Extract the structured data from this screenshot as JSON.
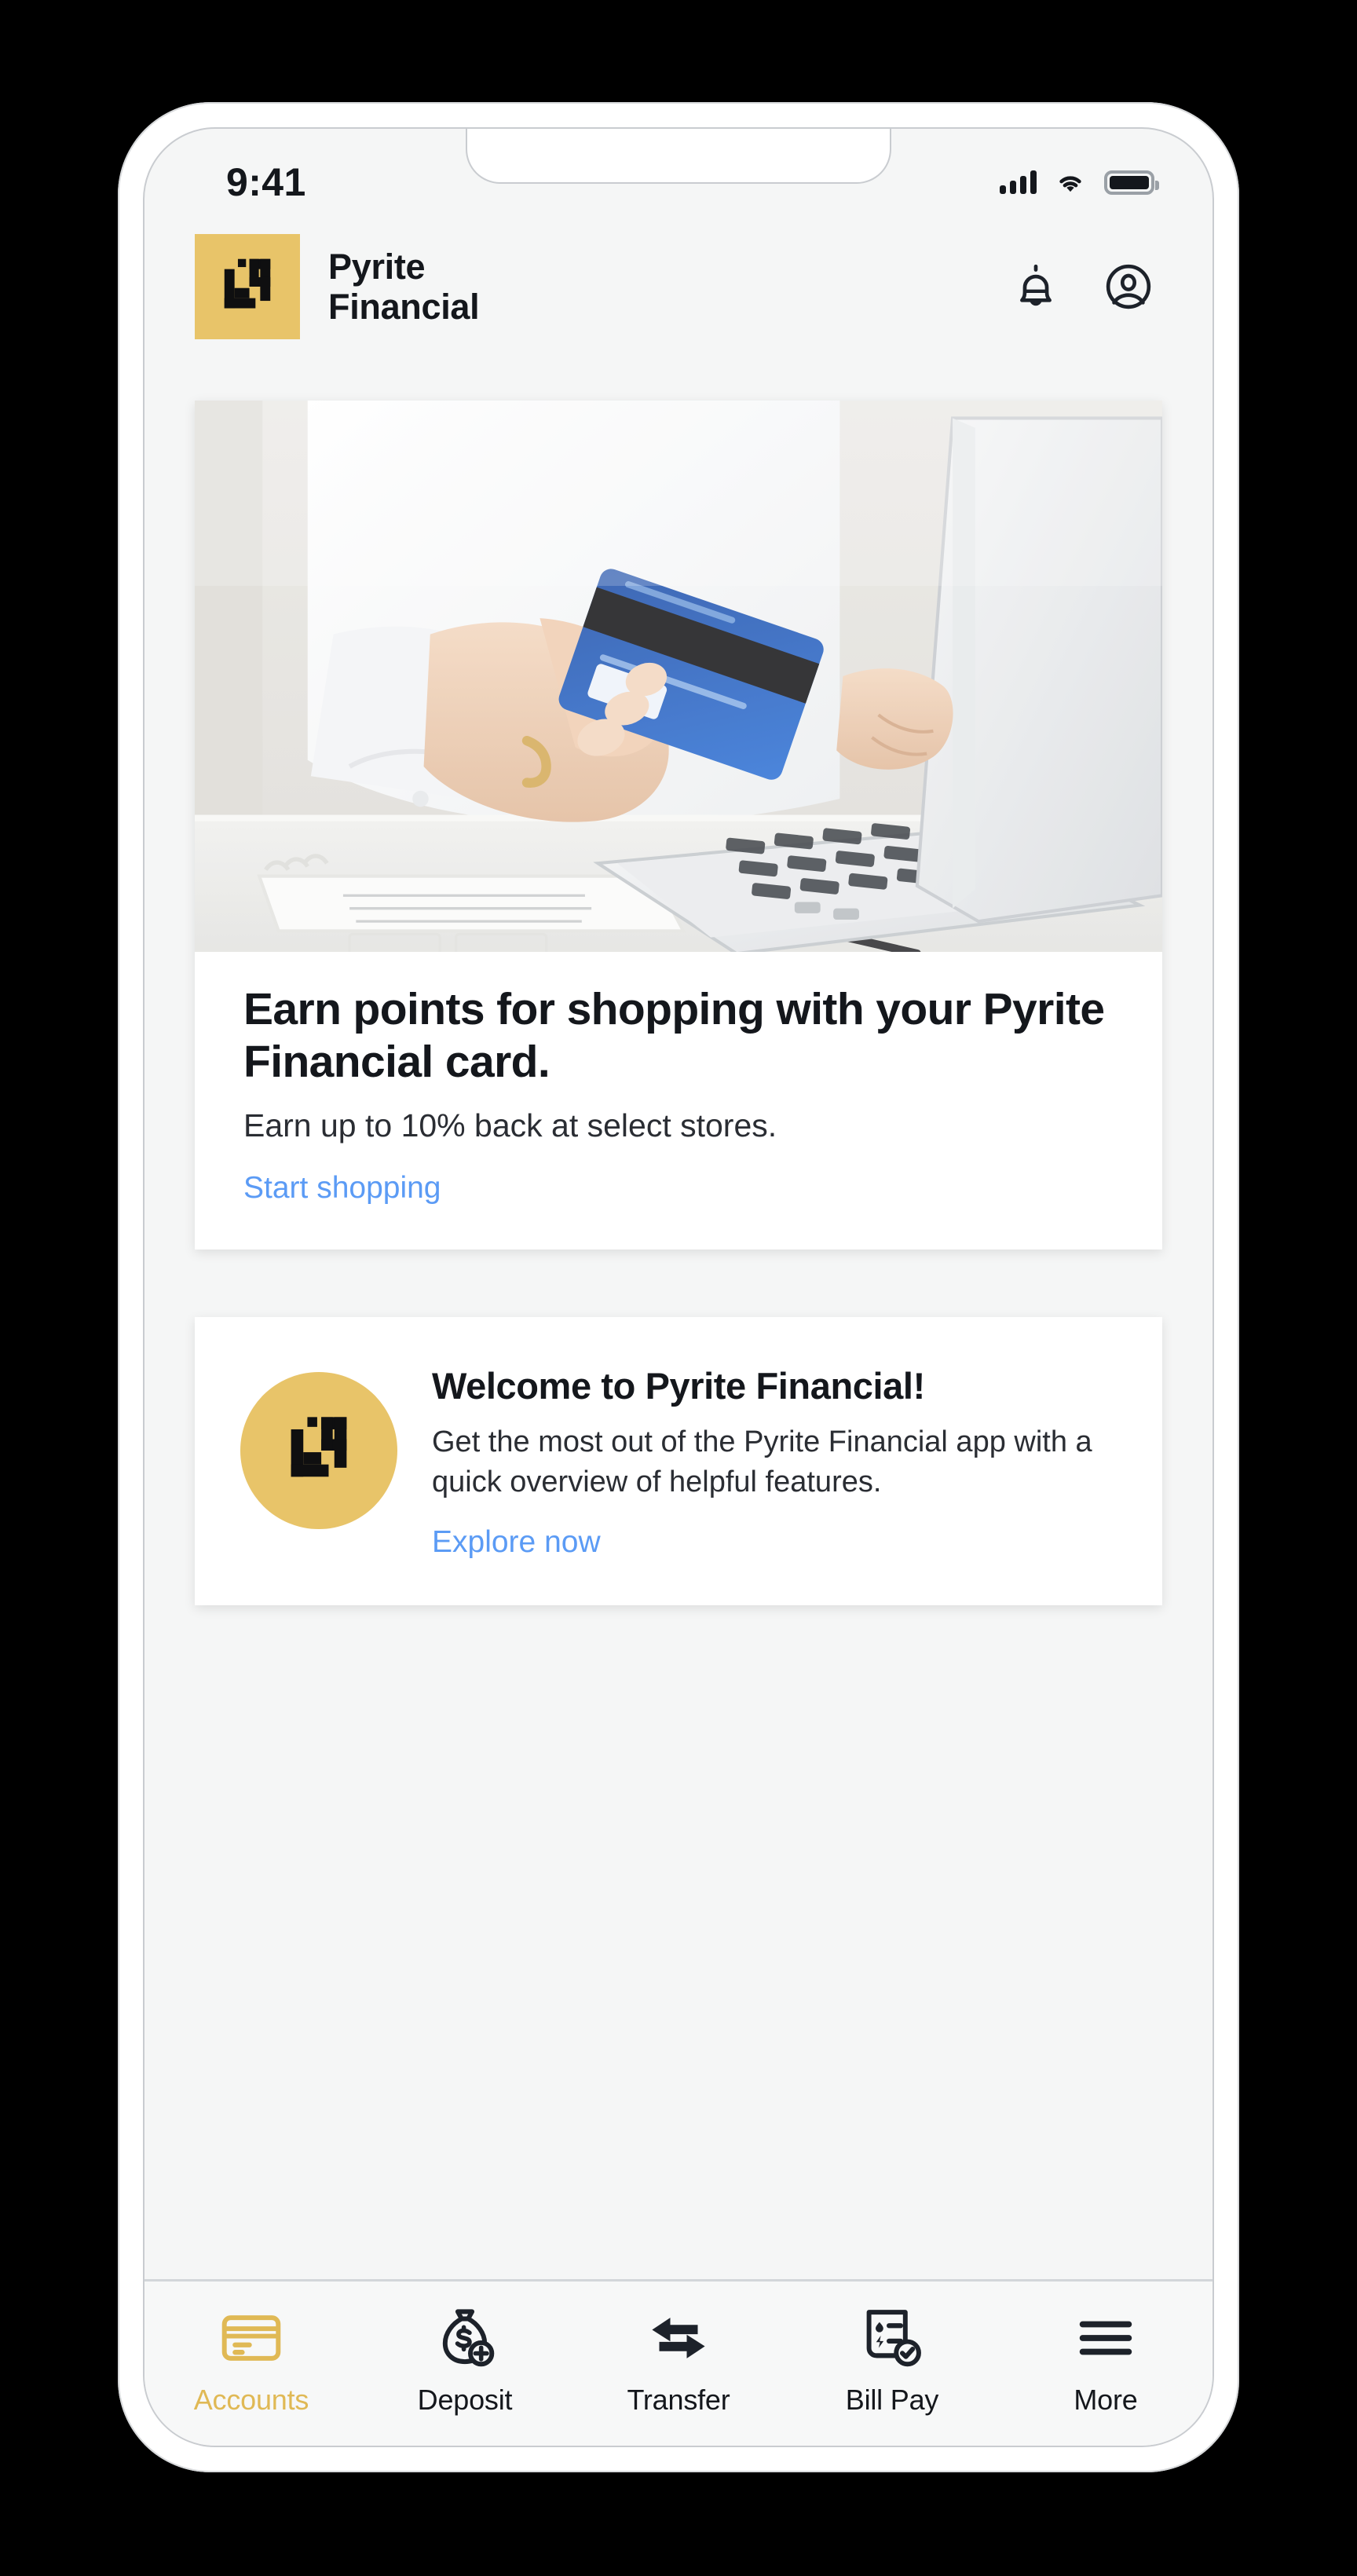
{
  "statusbar": {
    "time": "9:41",
    "signal_icon": "cellular-signal-icon",
    "wifi_icon": "wifi-icon",
    "battery_icon": "battery-full-icon"
  },
  "header": {
    "logo_icon": "pyrite-logo-icon",
    "brand_name": "Pyrite\nFinancial",
    "notifications_icon": "bell-icon",
    "profile_icon": "account-circle-icon"
  },
  "promo_card": {
    "hero_image_alt": "person-holding-credit-card-at-laptop",
    "title": "Earn points for shopping with your Pyrite Financial card.",
    "subtitle": "Earn up to 10% back at select stores.",
    "link_label": "Start shopping"
  },
  "welcome_card": {
    "badge_icon": "pyrite-logo-icon",
    "title": "Welcome to Pyrite Financial!",
    "body": "Get the most out of the Pyrite Financial app with a quick overview of helpful features.",
    "link_label": "Explore now"
  },
  "bottom_nav": {
    "active_index": 0,
    "items": [
      {
        "label": "Accounts",
        "icon": "credit-card-icon"
      },
      {
        "label": "Deposit",
        "icon": "money-bag-plus-icon"
      },
      {
        "label": "Transfer",
        "icon": "transfer-arrows-icon"
      },
      {
        "label": "Bill Pay",
        "icon": "invoice-check-icon"
      },
      {
        "label": "More",
        "icon": "hamburger-menu-icon"
      }
    ]
  },
  "colors": {
    "brand_gold": "#e8c469",
    "active_tab": "#e0b955",
    "link_blue": "#5b9bf5",
    "text_dark": "#14171c",
    "screen_bg": "#f5f6f6"
  }
}
